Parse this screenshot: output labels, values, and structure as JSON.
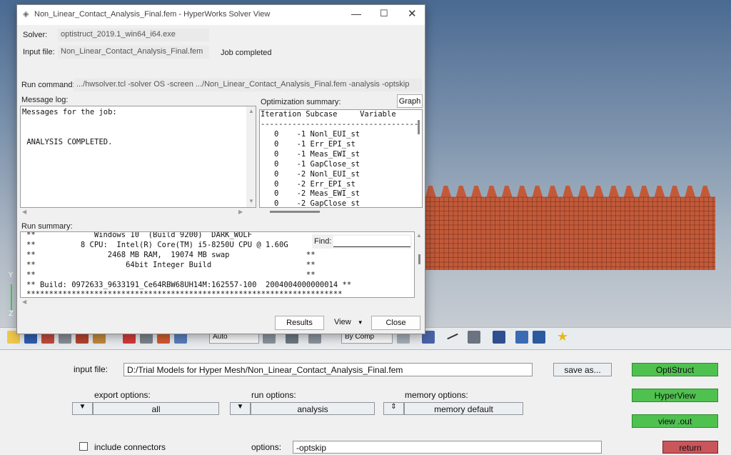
{
  "dialog": {
    "title": "Non_Linear_Contact_Analysis_Final.fem - HyperWorks Solver View",
    "solver_label": "Solver:",
    "solver_value": "optistruct_2019.1_win64_i64.exe",
    "input_label": "Input file:",
    "input_value": "Non_Linear_Contact_Analysis_Final.fem",
    "status": "Job completed",
    "run_cmd_label": "Run command:",
    "run_cmd_value": ".../hwsolver.tcl -solver OS -screen .../Non_Linear_Contact_Analysis_Final.fem -analysis -optskip",
    "message_log_label": "Message log:",
    "message_log_lines": [
      "Messages for the job:",
      "",
      "",
      " ANALYSIS COMPLETED."
    ],
    "opt_summary_label": "Optimization summary:",
    "graph_button": "Graph",
    "opt_header": "Iteration Subcase     Variable",
    "opt_separator": "-----------------------------------",
    "opt_rows": [
      [
        "0",
        "-1",
        "Nonl_EUI_st"
      ],
      [
        "0",
        "-1",
        "Err_EPI_st"
      ],
      [
        "0",
        "-1",
        "Meas_EWI_st"
      ],
      [
        "0",
        "-1",
        "GapClose_st"
      ],
      [
        "0",
        "-2",
        "Nonl_EUI_st"
      ],
      [
        "0",
        "-2",
        "Err_EPI_st"
      ],
      [
        "0",
        "-2",
        "Meas_EWI_st"
      ],
      [
        "0",
        "-2",
        "GapClose_st"
      ]
    ],
    "run_summary_label": "Run summary:",
    "run_summary_lines": [
      "**             Windows 10  (Build 9200)  DARK_WOLF",
      "**          8 CPU:  Intel(R) Core(TM) i5-8250U CPU @ 1.60G",
      "**                2468 MB RAM,  19074 MB swap                 **",
      "**                    64bit Integer Build                     **",
      "**                                                            **",
      "** Build: 0972633_9633191_Ce64RBW68UH14M:162557-100  2004004000000014 **",
      "**********************************************************************"
    ],
    "find_label": "Find:",
    "find_value": "",
    "results_button": "Results",
    "view_button": "View",
    "close_button": "Close"
  },
  "toolbar": {
    "auto_dropdown": "Auto",
    "bycomp_dropdown": "By Comp"
  },
  "axes": {
    "y": "Y",
    "z": "Z"
  },
  "panel": {
    "input_file_label": "input file:",
    "input_file_value": "D:/Trial Models for Hyper Mesh/Non_Linear_Contact_Analysis_Final.fem",
    "save_as_button": "save as...",
    "export_options_label": "export options:",
    "export_options_value": "all",
    "run_options_label": "run options:",
    "run_options_value": "analysis",
    "memory_options_label": "memory options:",
    "memory_options_value": "memory default",
    "include_connectors_label": "include connectors",
    "include_connectors_checked": false,
    "options_label": "options:",
    "options_value": "-optskip",
    "optistruct_button": "OptiStruct",
    "hyperview_button": "HyperView",
    "view_out_button": "view .out",
    "return_button": "return"
  },
  "colors": {
    "mesh_fill": "#c25a3a",
    "mesh_line": "#6e2a16",
    "green_button": "#4fc14f",
    "return_button": "#c9565b"
  }
}
